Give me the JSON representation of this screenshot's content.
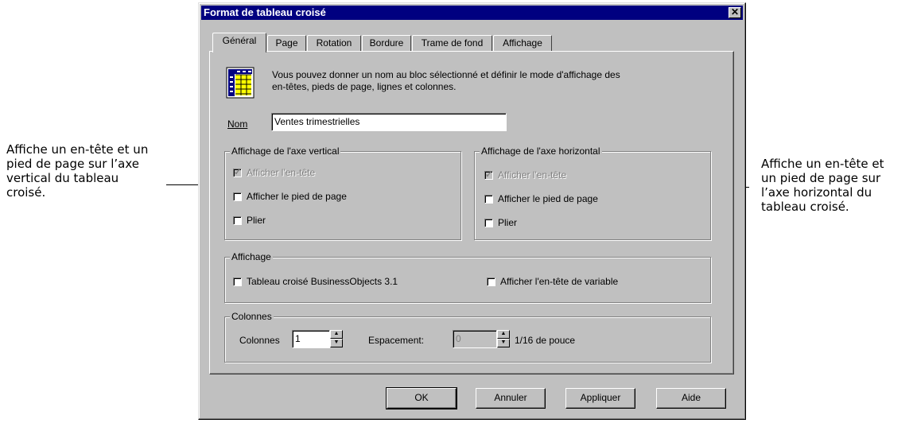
{
  "callouts": {
    "left": [
      "Affiche un en-tête et un",
      "pied de page sur l’axe",
      "vertical du tableau",
      "croisé."
    ],
    "right": [
      "Affiche un en-tête et",
      "un pied de page sur",
      "l’axe horizontal du",
      "tableau croisé."
    ]
  },
  "dialog": {
    "title": "Format de tableau croisé",
    "close_symbol": "✕"
  },
  "tabs": [
    {
      "label": "Général",
      "active": true
    },
    {
      "label": "Page",
      "active": false
    },
    {
      "label": "Rotation",
      "active": false
    },
    {
      "label": "Bordure",
      "active": false
    },
    {
      "label": "Trame de fond",
      "active": false
    },
    {
      "label": "Affichage",
      "active": false
    }
  ],
  "general": {
    "icon": "crosstab-icon",
    "description_line1": "Vous pouvez donner un nom au bloc sélectionné et définir le mode d'affichage des",
    "description_line2": "en-têtes, pieds de page, lignes et colonnes.",
    "name_label": "Nom",
    "name_value": "Ventes trimestrielles"
  },
  "vertical_axis": {
    "title": "Affichage de l'axe vertical",
    "show_header": {
      "label": "Afficher l'en-tête",
      "checked": true,
      "enabled": false
    },
    "show_footer": {
      "label": "Afficher le pied de page",
      "checked": false
    },
    "fold": {
      "label": "Plier",
      "checked": false
    }
  },
  "horizontal_axis": {
    "title": "Affichage de l'axe horizontal",
    "show_header": {
      "label": "Afficher l'en-tête",
      "checked": true,
      "enabled": false
    },
    "show_footer": {
      "label": "Afficher le pied de page",
      "checked": false
    },
    "fold": {
      "label": "Plier",
      "checked": false
    }
  },
  "display": {
    "title": "Affichage",
    "bo31": {
      "label": "Tableau croisé BusinessObjects 3.1",
      "checked": false
    },
    "variable_header": {
      "label": "Afficher l'en-tête de variable",
      "checked": false
    }
  },
  "columns": {
    "title": "Colonnes",
    "columns_label": "Colonnes",
    "columns_value": "1",
    "spacing_label": "Espacement:",
    "spacing_value": "0",
    "unit_label": "1/16 de pouce"
  },
  "buttons": {
    "ok": "OK",
    "cancel": "Annuler",
    "apply": "Appliquer",
    "help": "Aide"
  }
}
